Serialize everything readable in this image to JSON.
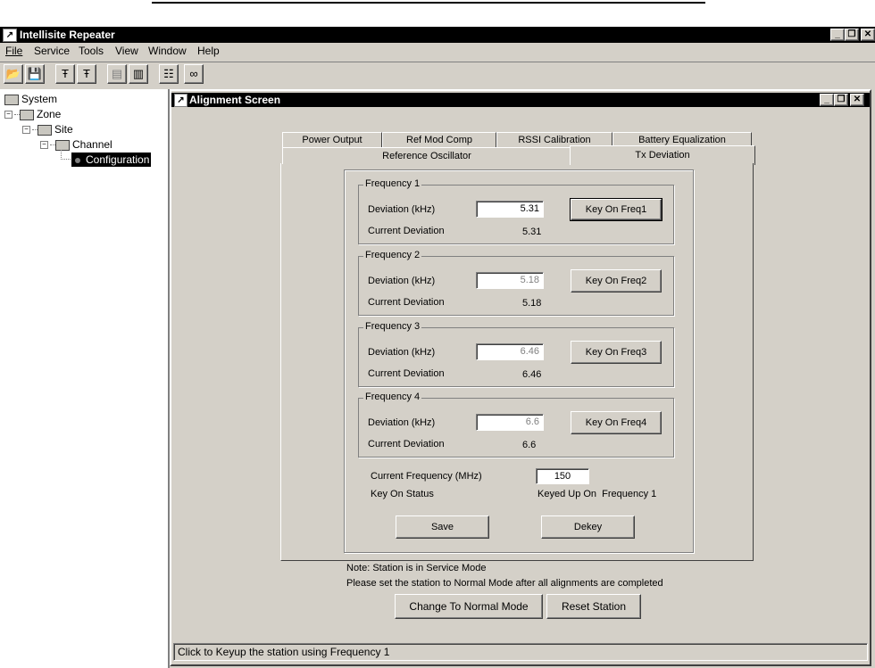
{
  "app": {
    "title": "Intellisite Repeater",
    "controls": {
      "minimize": "_",
      "restore": "❐",
      "close": "✕"
    }
  },
  "menu": {
    "items": [
      "File",
      "Service",
      "Tools",
      "View",
      "Window",
      "Help"
    ]
  },
  "toolbar": {
    "icons": [
      "open-folder-icon",
      "save-disk-icon",
      "antenna-icon",
      "antenna-icon",
      "card-icon",
      "document-icon",
      "tree-network-icon",
      "binoculars-icon"
    ]
  },
  "tree": {
    "system": "System",
    "zone": "Zone",
    "site": "Site",
    "channel": "Channel",
    "configuration": "Configuration"
  },
  "alignment": {
    "title": "Alignment Screen",
    "tabs_back": [
      "Power Output",
      "Ref Mod Comp",
      "RSSI Calibration",
      "Battery Equalization"
    ],
    "tabs_front": [
      "Reference Oscillator",
      "Tx Deviation"
    ],
    "active_tab": "Tx Deviation",
    "deviation_label": "Deviation (kHz)",
    "current_label": "Current Deviation",
    "frequencies": [
      {
        "group": "Frequency 1",
        "deviation": "5.31",
        "current": "5.31",
        "button": "Key On Freq1",
        "enabled": true
      },
      {
        "group": "Frequency 2",
        "deviation": "5.18",
        "current": "5.18",
        "button": "Key On Freq2",
        "enabled": false
      },
      {
        "group": "Frequency 3",
        "deviation": "6.46",
        "current": "6.46",
        "button": "Key On Freq3",
        "enabled": false
      },
      {
        "group": "Frequency 4",
        "deviation": "6.6",
        "current": "6.6",
        "button": "Key On Freq4",
        "enabled": false
      }
    ],
    "current_frequency_label": "Current Frequency (MHz)",
    "current_frequency_value": "150",
    "key_on_status_label": "Key On Status",
    "key_on_status_value": "Keyed Up On  Frequency 1",
    "save_button": "Save",
    "dekey_button": "Dekey",
    "note_line1": "Note: Station is in Service Mode",
    "note_line2": "Please set the station to Normal Mode after all alignments are completed",
    "normal_mode_button": "Change To Normal Mode",
    "reset_button": "Reset Station",
    "status_bar": "Click to Keyup the station using Frequency 1"
  },
  "colors": {
    "face": "#d4d0c8",
    "title": "#000000",
    "selection": "#000000"
  }
}
